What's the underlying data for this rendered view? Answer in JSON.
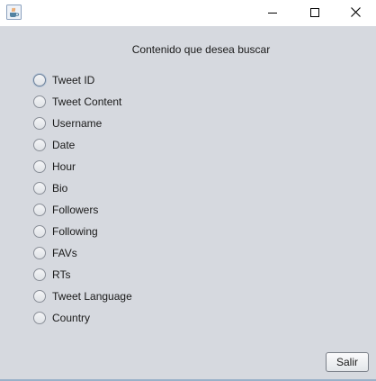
{
  "window": {
    "controls": {
      "minimize_icon": "minimize-icon",
      "maximize_icon": "maximize-icon",
      "close_icon": "close-icon"
    },
    "app_icon": "java-coffee-cup-icon"
  },
  "main": {
    "heading": "Contenido que desea buscar",
    "options": [
      "Tweet ID",
      "Tweet Content",
      "Username",
      "Date",
      "Hour",
      "Bio",
      "Followers",
      "Following",
      "FAVs",
      "RTs",
      "Tweet Language",
      "Country"
    ],
    "selected_option": null,
    "exit_label": "Salir"
  },
  "colors": {
    "panel_background": "#d6d9df",
    "titlebar_background": "#ffffff"
  }
}
